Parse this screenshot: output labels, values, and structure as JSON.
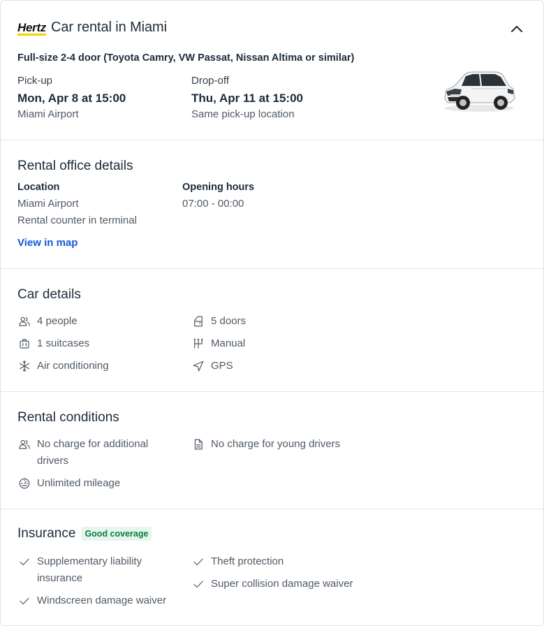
{
  "header": {
    "brand": "Hertz",
    "title": "Car rental in Miami",
    "car_model": "Full-size 2-4 door (Toyota Camry, VW Passat, Nissan Altima or similar)",
    "pickup": {
      "label": "Pick-up",
      "datetime": "Mon, Apr 8 at 15:00",
      "location": "Miami Airport"
    },
    "dropoff": {
      "label": "Drop-off",
      "datetime": "Thu, Apr 11 at 15:00",
      "location": "Same pick-up location"
    },
    "collapse_icon": "chevron-up-icon"
  },
  "office": {
    "title": "Rental office details",
    "location_label": "Location",
    "location_line1": "Miami Airport",
    "location_line2": "Rental counter in terminal",
    "hours_label": "Opening hours",
    "hours_value": "07:00 - 00:00",
    "map_link": "View in map"
  },
  "car_details": {
    "title": "Car details",
    "items": [
      {
        "icon": "people-icon",
        "text": "4 people"
      },
      {
        "icon": "door-icon",
        "text": "5 doors"
      },
      {
        "icon": "suitcase-icon",
        "text": "1 suitcases"
      },
      {
        "icon": "gearshift-icon",
        "text": "Manual"
      },
      {
        "icon": "snowflake-icon",
        "text": "Air conditioning"
      },
      {
        "icon": "navigation-icon",
        "text": "GPS"
      }
    ]
  },
  "conditions": {
    "title": "Rental conditions",
    "items": [
      {
        "icon": "people-icon",
        "text": "No charge for additional drivers"
      },
      {
        "icon": "document-icon",
        "text": "No charge for young drivers"
      },
      {
        "icon": "speedometer-icon",
        "text": "Unlimited mileage"
      }
    ]
  },
  "insurance": {
    "title": "Insurance",
    "badge": "Good coverage",
    "items": [
      {
        "icon": "check-icon",
        "text": "Supplementary liability insurance"
      },
      {
        "icon": "check-icon",
        "text": "Theft protection"
      },
      {
        "icon": "check-icon",
        "text": "Super collision damage waiver"
      },
      {
        "icon": "check-icon",
        "text": "Windscreen damage waiver"
      }
    ]
  },
  "colors": {
    "link": "#1458d8",
    "badge_bg": "#e6f6ee",
    "badge_text": "#0b7a3c",
    "brand_yellow": "#f5d300"
  }
}
